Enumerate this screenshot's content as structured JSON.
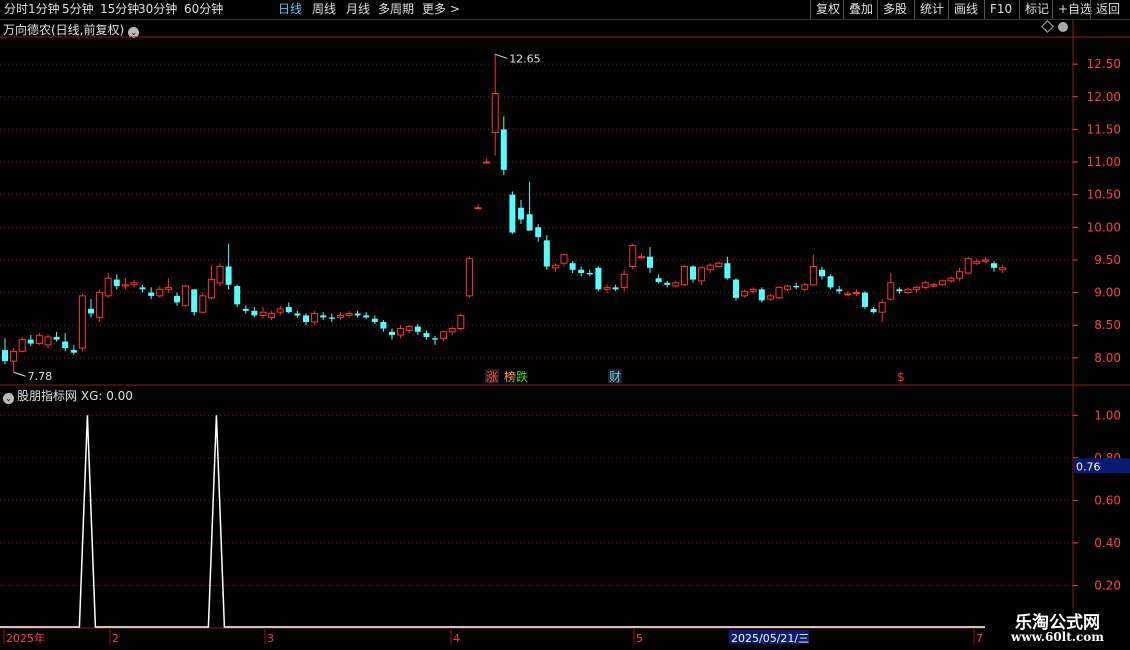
{
  "toolbar": {
    "periods": [
      "分时",
      "1分钟",
      "5分钟",
      "15分钟",
      "30分钟",
      "60分钟",
      "日线",
      "周线",
      "月线",
      "多周期",
      "更多 >"
    ],
    "active_period": "日线",
    "right_buttons": [
      "复权",
      "叠加",
      "多股",
      "统计",
      "画线",
      "F10",
      "标记",
      "+自选",
      "返回"
    ]
  },
  "chart": {
    "title": "万向德农(日线,前复权)",
    "price_axis_labels": [
      "12.50",
      "12.00",
      "11.50",
      "11.00",
      "10.50",
      "10.00",
      "9.50",
      "9.00",
      "8.50",
      "8.00"
    ],
    "high_label": "12.65",
    "low_label": "7.78",
    "event_markers": [
      {
        "text": "涨",
        "color": "#ff4040"
      },
      {
        "text": "榜",
        "color": "#ff9933"
      },
      {
        "text": "跌",
        "color": "#33dd33"
      },
      {
        "text": "财",
        "color": "#66ccff"
      },
      {
        "text": "$",
        "color": "#ff3030"
      }
    ]
  },
  "indicator": {
    "title": "股朋指标网",
    "value_text": "XG: 0.00",
    "axis_labels": [
      "1.00",
      "0.80",
      "0.60",
      "0.40",
      "0.20"
    ],
    "current_value": "0.76"
  },
  "date_axis": {
    "labels": [
      "2025年",
      "2",
      "3",
      "4",
      "5",
      "7"
    ],
    "cursor_date": "2025/05/21/三"
  },
  "watermark": {
    "line1": "乐淘公式网",
    "line2": "www.60lt.com"
  },
  "colors": {
    "up": "#ff3333",
    "down": "#54ffff",
    "grid": "#8b1a1a",
    "axis_text": "#ff4040",
    "indicator_line": "#ffffff"
  },
  "chart_data": {
    "type": "candlestick",
    "title": "万向德农(日线,前复权)",
    "ohlc": [
      [
        8.12,
        8.3,
        7.9,
        7.95
      ],
      [
        7.95,
        8.15,
        7.78,
        8.1
      ],
      [
        8.1,
        8.32,
        8.08,
        8.28
      ],
      [
        8.28,
        8.35,
        8.18,
        8.22
      ],
      [
        8.22,
        8.38,
        8.2,
        8.34
      ],
      [
        8.2,
        8.36,
        8.15,
        8.32
      ],
      [
        8.32,
        8.4,
        8.25,
        8.28
      ],
      [
        8.25,
        8.38,
        8.1,
        8.15
      ],
      [
        8.12,
        8.2,
        8.05,
        8.08
      ],
      [
        8.15,
        8.98,
        8.1,
        8.95
      ],
      [
        8.75,
        8.9,
        8.62,
        8.68
      ],
      [
        8.62,
        9.05,
        8.55,
        9.0
      ],
      [
        8.95,
        9.3,
        8.92,
        9.22
      ],
      [
        9.2,
        9.28,
        9.05,
        9.1
      ],
      [
        9.1,
        9.22,
        9.05,
        9.12
      ],
      [
        9.12,
        9.2,
        9.08,
        9.15
      ],
      [
        9.08,
        9.12,
        9.0,
        9.05
      ],
      [
        9.0,
        9.08,
        8.9,
        8.95
      ],
      [
        8.95,
        9.1,
        8.92,
        9.05
      ],
      [
        9.05,
        9.22,
        9.0,
        9.08
      ],
      [
        8.95,
        9.0,
        8.8,
        8.85
      ],
      [
        8.8,
        9.12,
        8.78,
        9.1
      ],
      [
        9.05,
        9.05,
        8.65,
        8.7
      ],
      [
        8.7,
        9.0,
        8.68,
        8.95
      ],
      [
        8.92,
        9.42,
        8.9,
        9.2
      ],
      [
        9.15,
        9.45,
        9.1,
        9.4
      ],
      [
        9.4,
        9.75,
        9.05,
        9.12
      ],
      [
        9.1,
        9.12,
        8.78,
        8.82
      ],
      [
        8.75,
        8.8,
        8.68,
        8.72
      ],
      [
        8.72,
        8.78,
        8.62,
        8.65
      ],
      [
        8.65,
        8.78,
        8.6,
        8.7
      ],
      [
        8.62,
        8.72,
        8.58,
        8.68
      ],
      [
        8.7,
        8.8,
        8.65,
        8.75
      ],
      [
        8.78,
        8.85,
        8.68,
        8.7
      ],
      [
        8.68,
        8.72,
        8.62,
        8.65
      ],
      [
        8.65,
        8.68,
        8.5,
        8.55
      ],
      [
        8.55,
        8.72,
        8.5,
        8.68
      ],
      [
        8.65,
        8.7,
        8.58,
        8.62
      ],
      [
        8.62,
        8.68,
        8.55,
        8.6
      ],
      [
        8.62,
        8.7,
        8.58,
        8.65
      ],
      [
        8.65,
        8.72,
        8.62,
        8.68
      ],
      [
        8.68,
        8.72,
        8.62,
        8.65
      ],
      [
        8.65,
        8.7,
        8.6,
        8.62
      ],
      [
        8.6,
        8.65,
        8.52,
        8.55
      ],
      [
        8.55,
        8.58,
        8.4,
        8.45
      ],
      [
        8.4,
        8.45,
        8.28,
        8.35
      ],
      [
        8.35,
        8.5,
        8.3,
        8.45
      ],
      [
        8.42,
        8.5,
        8.38,
        8.48
      ],
      [
        8.48,
        8.52,
        8.35,
        8.4
      ],
      [
        8.38,
        8.42,
        8.28,
        8.32
      ],
      [
        8.3,
        8.34,
        8.2,
        8.28
      ],
      [
        8.3,
        8.42,
        8.25,
        8.4
      ],
      [
        8.4,
        8.48,
        8.35,
        8.45
      ],
      [
        8.45,
        8.68,
        8.42,
        8.65
      ],
      [
        8.95,
        9.55,
        8.92,
        9.52
      ],
      [
        10.3,
        10.35,
        10.3,
        10.3
      ],
      [
        11.0,
        11.05,
        11.0,
        11.0
      ],
      [
        11.45,
        12.65,
        11.1,
        12.05
      ],
      [
        11.5,
        11.7,
        10.8,
        10.88
      ],
      [
        10.5,
        10.55,
        9.9,
        9.92
      ],
      [
        10.3,
        10.42,
        10.05,
        10.12
      ],
      [
        10.2,
        10.7,
        9.95,
        9.95
      ],
      [
        10.0,
        10.05,
        9.78,
        9.85
      ],
      [
        9.8,
        9.88,
        9.35,
        9.4
      ],
      [
        9.38,
        9.45,
        9.32,
        9.42
      ],
      [
        9.45,
        9.6,
        9.4,
        9.58
      ],
      [
        9.45,
        9.48,
        9.3,
        9.35
      ],
      [
        9.35,
        9.4,
        9.25,
        9.3
      ],
      [
        9.3,
        9.35,
        9.25,
        9.28
      ],
      [
        9.38,
        9.4,
        9.02,
        9.05
      ],
      [
        9.05,
        9.12,
        9.0,
        9.08
      ],
      [
        9.08,
        9.12,
        9.02,
        9.05
      ],
      [
        9.08,
        9.35,
        9.02,
        9.28
      ],
      [
        9.4,
        9.75,
        9.35,
        9.72
      ],
      [
        9.55,
        9.6,
        9.52,
        9.55
      ],
      [
        9.55,
        9.7,
        9.3,
        9.38
      ],
      [
        9.22,
        9.28,
        9.14,
        9.16
      ],
      [
        9.15,
        9.18,
        9.08,
        9.12
      ],
      [
        9.1,
        9.18,
        9.08,
        9.15
      ],
      [
        9.12,
        9.42,
        9.1,
        9.4
      ],
      [
        9.4,
        9.42,
        9.15,
        9.2
      ],
      [
        9.18,
        9.4,
        9.12,
        9.38
      ],
      [
        9.35,
        9.45,
        9.3,
        9.42
      ],
      [
        9.4,
        9.48,
        9.38,
        9.45
      ],
      [
        9.45,
        9.55,
        9.2,
        9.22
      ],
      [
        9.2,
        9.22,
        8.88,
        8.92
      ],
      [
        8.95,
        9.05,
        8.92,
        9.02
      ],
      [
        9.02,
        9.08,
        8.98,
        9.05
      ],
      [
        9.05,
        9.08,
        8.85,
        8.88
      ],
      [
        8.9,
        8.98,
        8.88,
        8.95
      ],
      [
        8.92,
        9.1,
        8.9,
        9.08
      ],
      [
        9.05,
        9.12,
        9.02,
        9.1
      ],
      [
        9.1,
        9.15,
        9.05,
        9.08
      ],
      [
        9.05,
        9.15,
        9.02,
        9.12
      ],
      [
        9.12,
        9.58,
        9.1,
        9.4
      ],
      [
        9.35,
        9.4,
        9.2,
        9.25
      ],
      [
        9.25,
        9.28,
        9.05,
        9.08
      ],
      [
        9.05,
        9.1,
        8.98,
        9.02
      ],
      [
        8.98,
        9.02,
        8.95,
        8.98
      ],
      [
        9.0,
        9.05,
        8.95,
        9.0
      ],
      [
        9.0,
        9.02,
        8.75,
        8.78
      ],
      [
        8.75,
        8.78,
        8.68,
        8.7
      ],
      [
        8.7,
        8.9,
        8.55,
        8.85
      ],
      [
        8.9,
        9.3,
        8.88,
        9.15
      ],
      [
        9.05,
        9.08,
        8.98,
        9.02
      ],
      [
        9.0,
        9.08,
        8.98,
        9.05
      ],
      [
        9.05,
        9.1,
        9.0,
        9.08
      ],
      [
        9.08,
        9.18,
        9.05,
        9.15
      ],
      [
        9.1,
        9.15,
        9.08,
        9.12
      ],
      [
        9.12,
        9.2,
        9.1,
        9.18
      ],
      [
        9.18,
        9.25,
        9.15,
        9.22
      ],
      [
        9.22,
        9.38,
        9.18,
        9.32
      ],
      [
        9.3,
        9.55,
        9.28,
        9.52
      ],
      [
        9.45,
        9.52,
        9.42,
        9.48
      ],
      [
        9.48,
        9.55,
        9.45,
        9.5
      ],
      [
        9.45,
        9.48,
        9.32,
        9.38
      ],
      [
        9.35,
        9.42,
        9.3,
        9.38
      ]
    ],
    "indicator_series": {
      "name": "XG",
      "values_at_index": {
        "9": 1,
        "24": 1
      },
      "default": 0
    },
    "ylim": [
      7.6,
      12.9
    ]
  }
}
